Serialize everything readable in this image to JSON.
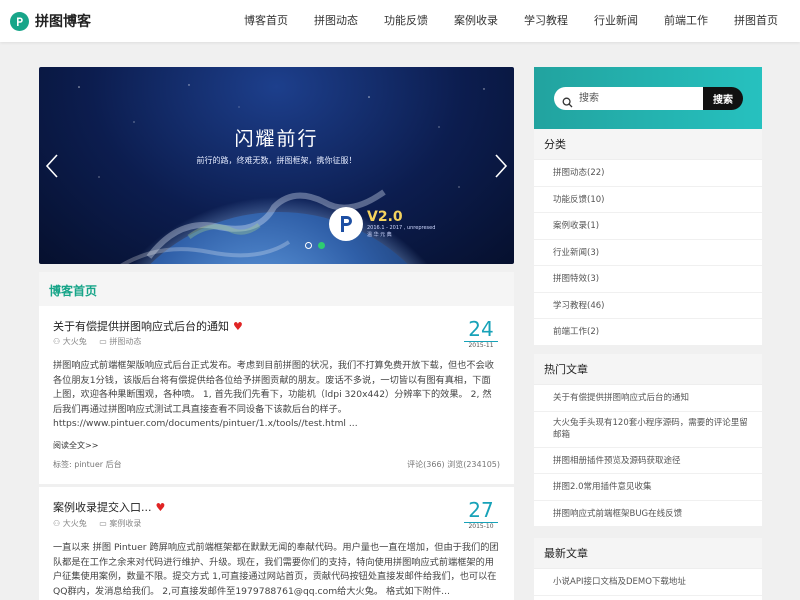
{
  "header": {
    "logo_text": "拼图博客",
    "nav": [
      "博客首页",
      "拼图动态",
      "功能反馈",
      "案例收录",
      "学习教程",
      "行业新闻",
      "前端工作",
      "拼图首页"
    ]
  },
  "slider": {
    "title": "闪耀前行",
    "subtitle": "前行的路，终难无数，拼图框架，携你征服！",
    "badge_version": "V2.0",
    "badge_small_1": "2016.1 - 2017 , unrepresed",
    "badge_small_2": "温 华 元 典",
    "active_dot": 2
  },
  "section_title": "博客首页",
  "posts": [
    {
      "title": "关于有偿提供拼图响应式后台的通知",
      "author": "大火兔",
      "category": "拼图动态",
      "day": "24",
      "year_month": "2015-11",
      "body": "拼图响应式前端框架版响应式后台正式发布。考虑到目前拼图的状况，我们不打算免费开放下载，但也不会收各位朋友1分钱，该版后台将有偿提供给各位给予拼图贡献的朋友。废话不多说，一切皆以有图有真相，下面上图，欢迎各种果断围观，各种喷。 1, 首先我们先看下，功能机（ldpi 320x442）分辨率下的效果。 2, 然后我们再通过拼图响应式测试工具直接查看不同设备下该款后台的样子。 https://www.pintuer.com/documents/pintuer/1.x/tools//test.html ...",
      "read_more": "阅读全文>>",
      "tags": "标签: pintuer 后台",
      "stats": "评论(366)   浏览(234105)"
    },
    {
      "title": "案例收录提交入口...",
      "author": "大火兔",
      "category": "案例收录",
      "day": "27",
      "year_month": "2015-10",
      "body": "一直以来 拼图 Pintuer 跨屏响应式前端框架都在默默无闻的奉献代码。用户量也一直在增加，但由于我们的团队都是在工作之余来对代码进行维护、升级。现在，我们需要你们的支持，特向使用拼图响应式前端框架的用户征集使用案例，数量不限。提交方式 1,可直接通过网站首页，贡献代码按钮处直接发邮件给我们，也可以在QQ群内，发消息给我们。 2,可直接发邮件至1979788761@qq.com给大火兔。     格式如下附件..."
    }
  ],
  "search": {
    "placeholder": "搜索",
    "button": "搜索"
  },
  "categories": {
    "title": "分类",
    "items": [
      "拼图动态(22)",
      "功能反馈(10)",
      "案例收录(1)",
      "行业新闻(3)",
      "拼图特效(3)",
      "学习教程(46)",
      "前端工作(2)"
    ]
  },
  "hot_articles": {
    "title": "热门文章",
    "items": [
      "关于有偿提供拼图响应式后台的通知",
      "大火兔手头现有120套小程序源码，需要的评论里留邮箱",
      "拼图相册插件预览及源码获取途径",
      "拼图2.0常用插件意见收集",
      "拼图响应式前端框架BUG在线反馈"
    ]
  },
  "latest_articles": {
    "title": "最新文章",
    "items": [
      "小说API接口文档及DEMO下载地址"
    ]
  },
  "colors": {
    "accent": "#17a589",
    "date": "#17a2b8",
    "heart": "#e02424"
  }
}
